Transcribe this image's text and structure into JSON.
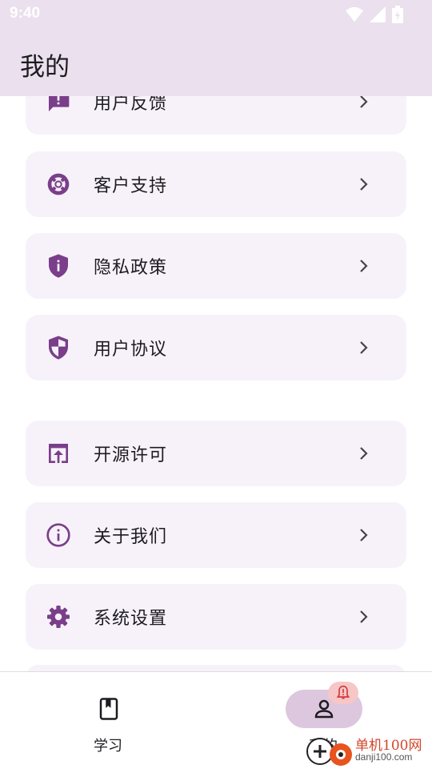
{
  "status_bar": {
    "time": "9:40"
  },
  "app_bar": {
    "title": "我的"
  },
  "menu_items": [
    {
      "label": "用户反馈",
      "icon": "feedback-icon"
    },
    {
      "label": "客户支持",
      "icon": "lifebuoy-icon"
    },
    {
      "label": "隐私政策",
      "icon": "shield-info-icon"
    },
    {
      "label": "用户协议",
      "icon": "shield-half-icon"
    },
    {
      "label": "开源许可",
      "icon": "open-in-new-icon"
    },
    {
      "label": "关于我们",
      "icon": "info-icon"
    },
    {
      "label": "系统设置",
      "icon": "gear-icon"
    }
  ],
  "bottom_nav": {
    "items": [
      {
        "label": "学习",
        "icon": "book-icon",
        "selected": false
      },
      {
        "label": "我的",
        "icon": "person-icon",
        "selected": true
      }
    ]
  },
  "watermark": {
    "text": "单机100网",
    "sub": "danji100.com"
  },
  "colors": {
    "accent": "#7a3e8a",
    "app_bar_bg": "#ebe0ed",
    "card_bg": "#f7f2f9",
    "nav_selected_bg": "#dcc7de"
  }
}
